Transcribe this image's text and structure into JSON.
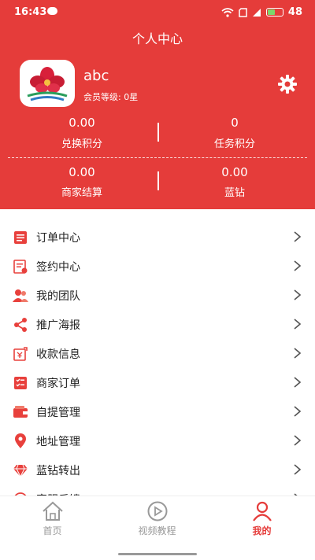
{
  "status_bar": {
    "time": "16:43",
    "battery": "48"
  },
  "header": {
    "title": "个人中心"
  },
  "profile": {
    "username": "abc",
    "level": "会员等级: 0星"
  },
  "stats": [
    {
      "value": "0.00",
      "label": "兑换积分"
    },
    {
      "value": "0",
      "label": "任务积分"
    },
    {
      "value": "0.00",
      "label": "商家结算"
    },
    {
      "value": "0.00",
      "label": "蓝钻"
    }
  ],
  "menu": [
    {
      "label": "订单中心",
      "icon": "order-icon"
    },
    {
      "label": "签约中心",
      "icon": "contract-icon"
    },
    {
      "label": "我的团队",
      "icon": "team-icon"
    },
    {
      "label": "推广海报",
      "icon": "share-icon"
    },
    {
      "label": "收款信息",
      "icon": "payment-icon"
    },
    {
      "label": "商家订单",
      "icon": "merchant-order-icon"
    },
    {
      "label": "自提管理",
      "icon": "wallet-icon"
    },
    {
      "label": "地址管理",
      "icon": "location-icon"
    },
    {
      "label": "蓝钻转出",
      "icon": "diamond-icon"
    },
    {
      "label": "客服反馈",
      "icon": "feedback-icon"
    }
  ],
  "tabs": [
    {
      "label": "首页"
    },
    {
      "label": "视频教程"
    },
    {
      "label": "我的"
    }
  ],
  "colors": {
    "primary": "#e53c3a",
    "icon_red": "#e8403c",
    "text": "#222222",
    "tab_inactive": "#999999"
  }
}
